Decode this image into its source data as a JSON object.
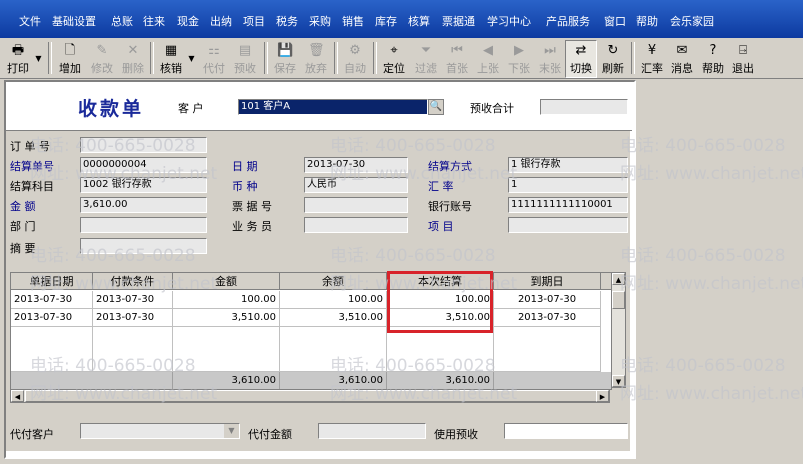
{
  "menu": [
    "文件",
    "基础设置",
    "总账",
    "往来",
    "现金",
    "出纳",
    "项目",
    "税务",
    "采购",
    "销售",
    "库存",
    "核算",
    "票据通",
    "学习中心",
    "产品服务",
    "窗口",
    "帮助",
    "会乐家园"
  ],
  "toolbar": {
    "print": "打印",
    "add": "增加",
    "edit": "修改",
    "delete": "删除",
    "verify": "核销",
    "pay_for": "代付",
    "prepay": "预收",
    "save": "保存",
    "discard": "放弃",
    "auto": "自动",
    "locate": "定位",
    "filter": "过滤",
    "first": "首张",
    "prev": "上张",
    "next": "下张",
    "last": "末张",
    "switch": "切换",
    "refresh": "刷新",
    "rate": "汇率",
    "message": "消息",
    "help": "帮助",
    "exit": "退出"
  },
  "form": {
    "title": "收款单",
    "customer_label": "客 户",
    "customer_value": "101  客户A",
    "prepay_total_label": "预收合计",
    "prepay_total_value": "",
    "order_no_label": "订 单 号",
    "order_no_value": "",
    "settle_no_label": "结算单号",
    "settle_no_value": "0000000004",
    "date_label": "日  期",
    "date_value": "2013-07-30",
    "settle_method_label": "结算方式",
    "settle_method_value": "1  银行存款",
    "settle_subject_label": "结算科目",
    "settle_subject_value": "1002  银行存款",
    "currency_label": "币  种",
    "currency_value": "人民币",
    "rate_label": "汇  率",
    "rate_value": "1",
    "amount_label": "金  额",
    "amount_value": "3,610.00",
    "bill_no_label": "票 据 号",
    "bill_no_value": "",
    "bank_account_label": "银行账号",
    "bank_account_value": "1111111111110001",
    "dept_label": "部  门",
    "dept_value": "",
    "salesman_label": "业 务 员",
    "salesman_value": "",
    "project_label": "项  目",
    "project_value": "",
    "summary_label": "摘  要",
    "summary_value": ""
  },
  "grid": {
    "headers": [
      "单据日期",
      "付款条件",
      "金额",
      "余额",
      "本次结算",
      "到期日"
    ],
    "rows": [
      [
        "2013-07-30",
        "2013-07-30",
        "100.00",
        "100.00",
        "100.00",
        "2013-07-30"
      ],
      [
        "2013-07-30",
        "2013-07-30",
        "3,510.00",
        "3,510.00",
        "3,510.00",
        "2013-07-30"
      ]
    ],
    "totals": {
      "amount": "3,610.00",
      "balance": "3,610.00",
      "settle": "3,610.00"
    }
  },
  "footer": {
    "pay_customer_label": "代付客户",
    "pay_customer_value": "",
    "pay_amount_label": "代付金额",
    "pay_amount_value": "",
    "use_prepay_label": "使用预收",
    "use_prepay_value": ""
  },
  "watermark": {
    "phone": "电话: 400-665-0028",
    "site": "网址: www.chanjet.net"
  },
  "colors": {
    "highlight": "#d8232a",
    "menu_bg": "#1e4fb8",
    "label_blue": "#00008b"
  }
}
